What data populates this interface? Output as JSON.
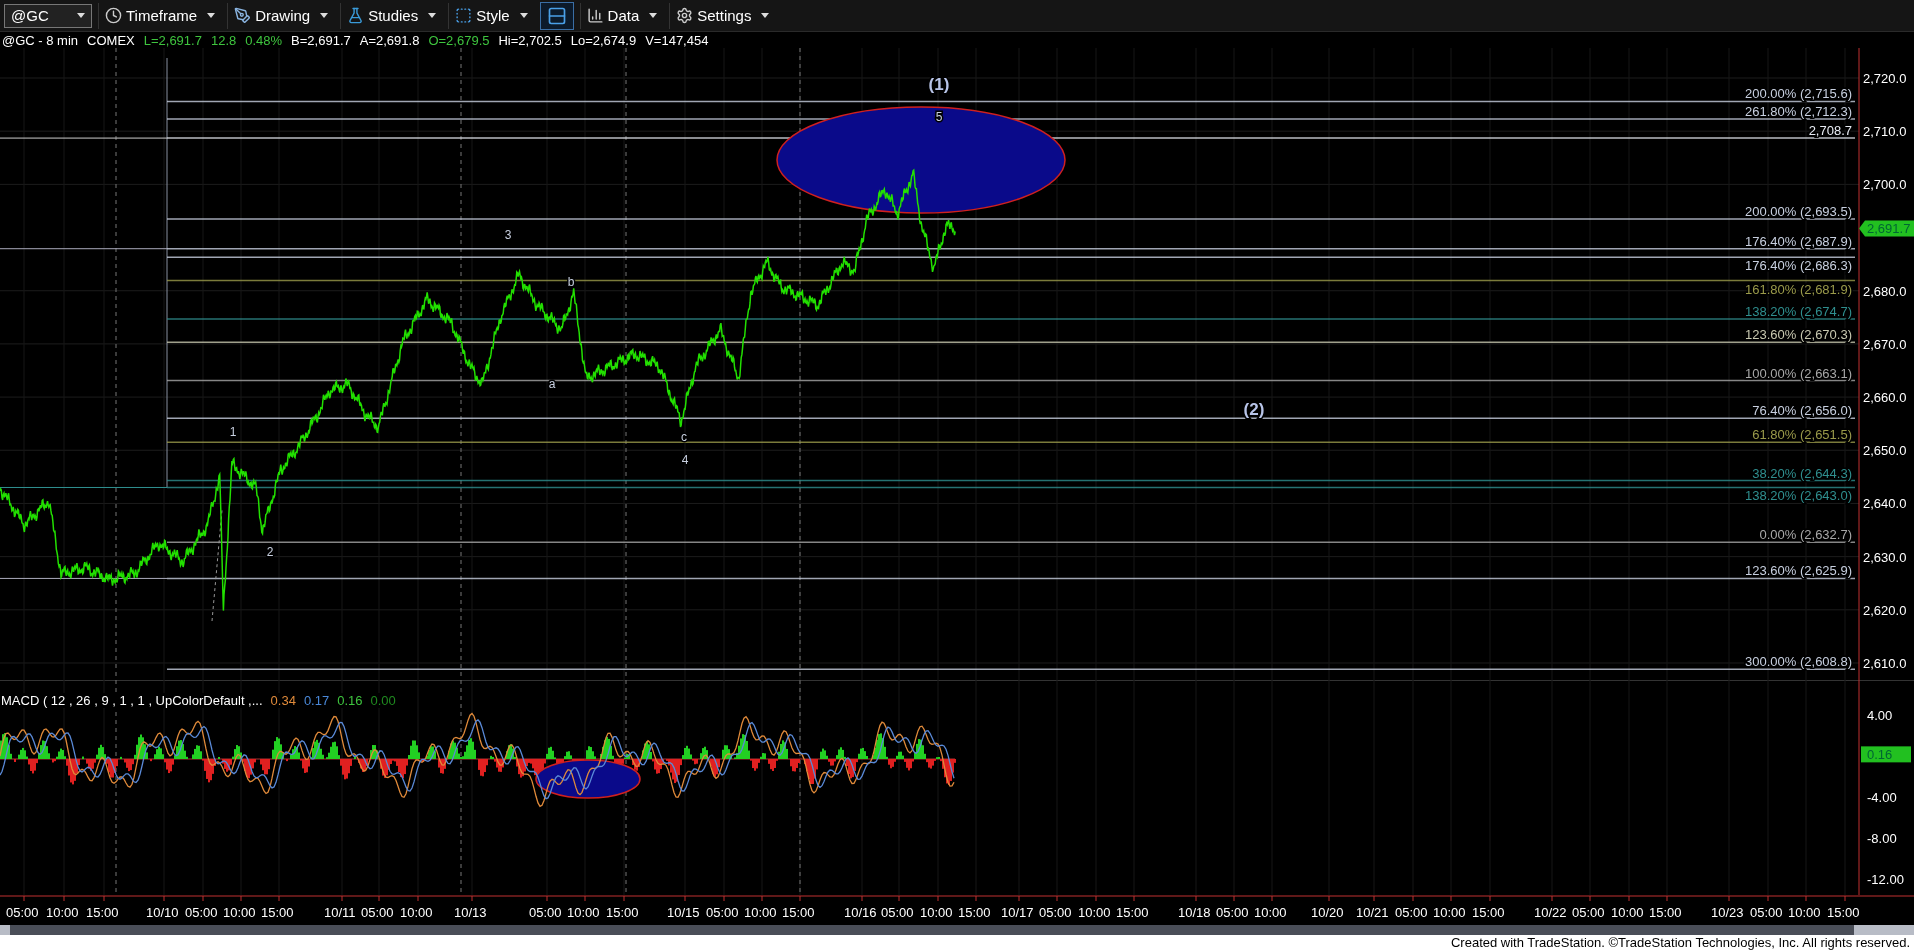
{
  "toolbar": {
    "symbol": "@GC",
    "buttons": [
      {
        "kind": "clock",
        "label": "Timeframe"
      },
      {
        "kind": "pen",
        "label": "Drawing"
      },
      {
        "kind": "flask",
        "label": "Studies"
      },
      {
        "kind": "style",
        "label": "Style"
      },
      {
        "kind": "layout"
      },
      {
        "kind": "data",
        "label": "Data"
      },
      {
        "kind": "settings",
        "label": "Settings"
      }
    ]
  },
  "quote_bar": [
    {
      "text": "@GC - 8 min",
      "color": "#ffffff"
    },
    {
      "text": "COMEX",
      "color": "#ffffff"
    },
    {
      "text": "L=2,691.7",
      "color": "#3ec43e"
    },
    {
      "text": "12.8",
      "color": "#3ec43e"
    },
    {
      "text": "0.48%",
      "color": "#3ec43e"
    },
    {
      "text": "B=2,691.7",
      "color": "#ffffff"
    },
    {
      "text": "A=2,691.8",
      "color": "#ffffff"
    },
    {
      "text": "O=2,679.5",
      "color": "#3ec43e"
    },
    {
      "text": "Hi=2,702.5",
      "color": "#ffffff"
    },
    {
      "text": "Lo=2,674.9",
      "color": "#ffffff"
    },
    {
      "text": "V=147,454",
      "color": "#ffffff"
    }
  ],
  "price_chart": {
    "fib_levels": [
      {
        "label": "200.00% (2,715.6)",
        "color": "#c8d0e0"
      },
      {
        "label": "261.80% (2,712.3)",
        "color": "#c8d0e0"
      },
      {
        "label": "2,708.7",
        "color": "#e8ecf4"
      },
      {
        "label": "200.00% (2,693.5)",
        "color": "#c8d0e0"
      },
      {
        "label": "176.40% (2,687.9)",
        "color": "#c8d0e0"
      },
      {
        "label": "176.40% (2,686.3)",
        "color": "#c8d0e0"
      },
      {
        "label": "161.80% (2,681.9)",
        "color": "#9a9a4a"
      },
      {
        "label": "138.20% (2,674.7)",
        "color": "#2f8f8f"
      },
      {
        "label": "123.60% (2,670.3)",
        "color": "#c8c8b0"
      },
      {
        "label": "100.00% (2,663.1)",
        "color": "#a8a8a8"
      },
      {
        "label": "76.40% (2,656.0)",
        "color": "#c8d0e0"
      },
      {
        "label": "61.80% (2,651.5)",
        "color": "#9a9a4a"
      },
      {
        "label": "38.20% (2,644.3)",
        "color": "#2f8f8f"
      },
      {
        "label": "138.20% (2,643.0)",
        "color": "#2f8f8f"
      },
      {
        "label": "0.00% (2,632.7)",
        "color": "#a8a8a8"
      },
      {
        "label": "123.60% (2,625.9)",
        "color": "#c8d0e0"
      },
      {
        "label": "300.00% (2,608.8)",
        "color": "#c8d0e0"
      }
    ],
    "wave_labels": [
      {
        "text": "1",
        "kind": "minor"
      },
      {
        "text": "2",
        "kind": "minor"
      },
      {
        "text": "3",
        "kind": "minor"
      },
      {
        "text": "a",
        "kind": "minor"
      },
      {
        "text": "b",
        "kind": "minor"
      },
      {
        "text": "c",
        "kind": "minor"
      },
      {
        "text": "4",
        "kind": "minor"
      },
      {
        "text": "5",
        "kind": "minor"
      },
      {
        "text": "(1)",
        "kind": "major"
      },
      {
        "text": "(2)",
        "kind": "major"
      }
    ],
    "price_axis": [
      "2,720.0",
      "2,710.0",
      "2,700.0",
      "2,680.0",
      "2,670.0",
      "2,660.0",
      "2,650.0",
      "2,640.0",
      "2,630.0",
      "2,620.0",
      "2,610.0"
    ],
    "last_price": "2,691.7"
  },
  "macd": {
    "legend": [
      {
        "text": "MACD ( 12 , 26 , 9 , 1 , 1 , UpColorDefault ,...",
        "color": "#ffffff"
      },
      {
        "text": "0.34",
        "color": "#e08a3a"
      },
      {
        "text": "0.17",
        "color": "#4a88d8"
      },
      {
        "text": "0.16",
        "color": "#3ec43e"
      },
      {
        "text": "0.00",
        "color": "#1f8a1f"
      }
    ],
    "axis": [
      "4.00",
      "-4.00",
      "-8.00",
      "-12.00"
    ],
    "last_value": "0.16"
  },
  "time_axis": [
    "05:00",
    "10:00",
    "15:00",
    "10/10",
    "05:00",
    "10:00",
    "15:00",
    "10/11",
    "05:00",
    "10:00",
    "10/13",
    "05:00",
    "10:00",
    "15:00",
    "10/15",
    "05:00",
    "10:00",
    "15:00",
    "10/16",
    "05:00",
    "10:00",
    "15:00",
    "10/17",
    "05:00",
    "10:00",
    "15:00",
    "10/18",
    "05:00",
    "10:00",
    "10/20",
    "10/21",
    "05:00",
    "10:00",
    "15:00",
    "10/22",
    "05:00",
    "10:00",
    "15:00",
    "10/23",
    "05:00",
    "10:00",
    "15:00"
  ],
  "footer": "Created with TradeStation. ©TradeStation Technologies, Inc. All rights reserved."
}
